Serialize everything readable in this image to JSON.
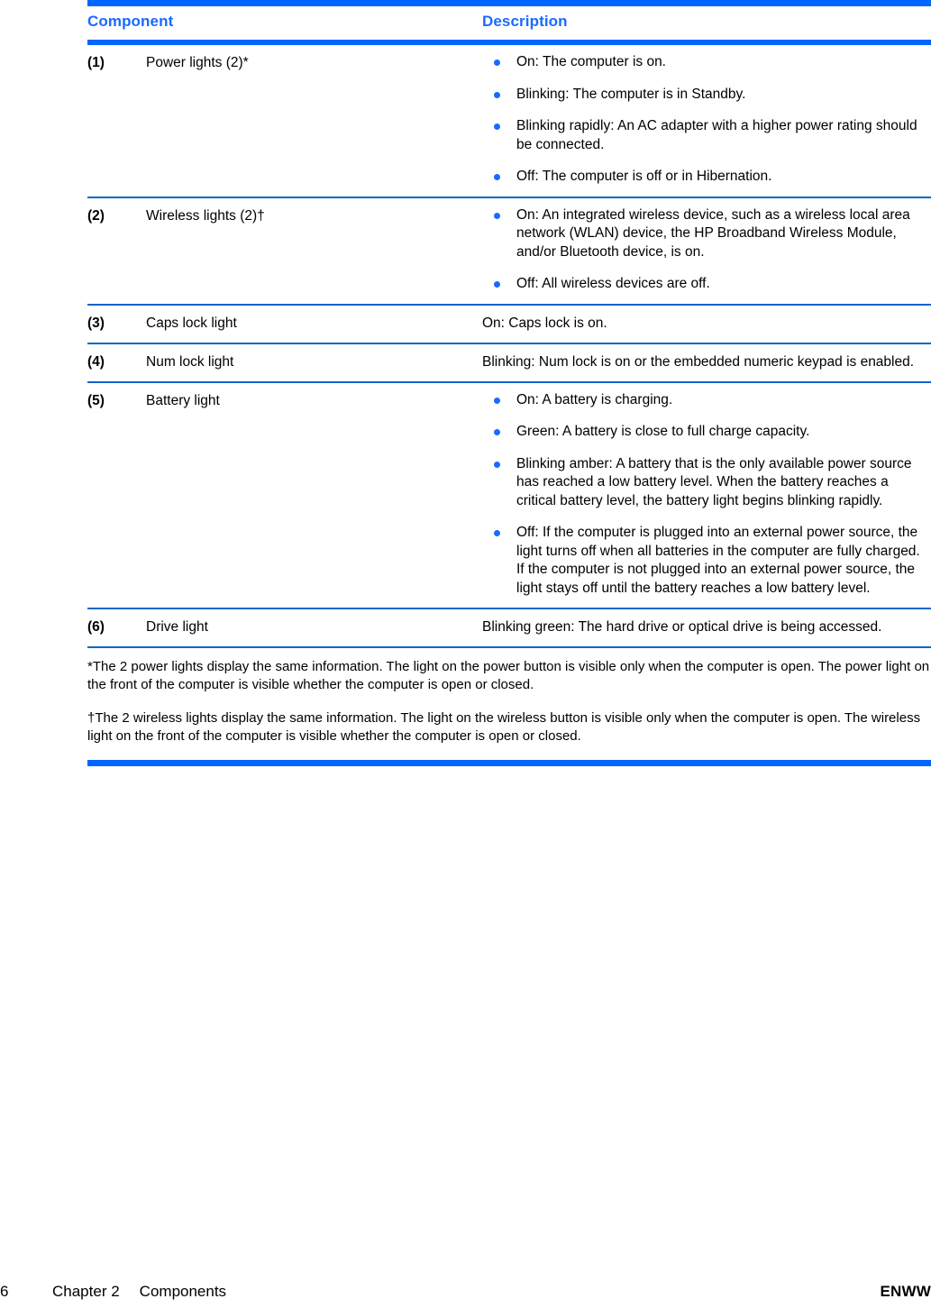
{
  "colors": {
    "accent_blue": "#0066ff",
    "rule_blue": "#0e66c8",
    "bullet_blue": "#1a6aff",
    "header_text_blue": "#1a6aff",
    "body_text": "#000000"
  },
  "table": {
    "headers": {
      "component": "Component",
      "description": "Description"
    },
    "rows": [
      {
        "number": "(1)",
        "component": "Power lights (2)*",
        "description_type": "bullets",
        "bullets": [
          "On: The computer is on.",
          "Blinking: The computer is in Standby.",
          "Blinking rapidly: An AC adapter with a higher power rating should be connected.",
          "Off: The computer is off or in Hibernation."
        ]
      },
      {
        "number": "(2)",
        "component": "Wireless lights (2)†",
        "description_type": "bullets",
        "bullets": [
          "On: An integrated wireless device, such as a wireless local area network (WLAN) device, the HP Broadband Wireless Module, and/or Bluetooth device, is on.",
          "Off: All wireless devices are off."
        ]
      },
      {
        "number": "(3)",
        "component": "Caps lock light",
        "description_type": "text",
        "text": "On: Caps lock is on."
      },
      {
        "number": "(4)",
        "component": "Num lock light",
        "description_type": "text",
        "text": "Blinking: Num lock is on or the embedded numeric keypad is enabled."
      },
      {
        "number": "(5)",
        "component": "Battery light",
        "description_type": "bullets",
        "bullets": [
          "On: A battery is charging.",
          "Green: A battery is close to full charge capacity.",
          "Blinking amber: A battery that is the only available power source has reached a low battery level. When the battery reaches a critical battery level, the battery light begins blinking rapidly.",
          "Off: If the computer is plugged into an external power source, the light turns off when all batteries in the computer are fully charged. If the computer is not plugged into an external power source, the light stays off until the battery reaches a low battery level."
        ]
      },
      {
        "number": "(6)",
        "component": "Drive light",
        "description_type": "text",
        "text": "Blinking green: The hard drive or optical drive is being accessed."
      }
    ],
    "footnotes": [
      "*The 2 power lights display the same information. The light on the power button is visible only when the computer is open. The power light on the front of the computer is visible whether the computer is open or closed.",
      "†The 2 wireless lights display the same information. The light on the wireless button is visible only when the computer is open. The wireless light on the front of the computer is visible whether the computer is open or closed."
    ]
  },
  "footer": {
    "page_number": "6",
    "chapter": "Chapter 2",
    "section": "Components",
    "locale": "ENWW"
  }
}
